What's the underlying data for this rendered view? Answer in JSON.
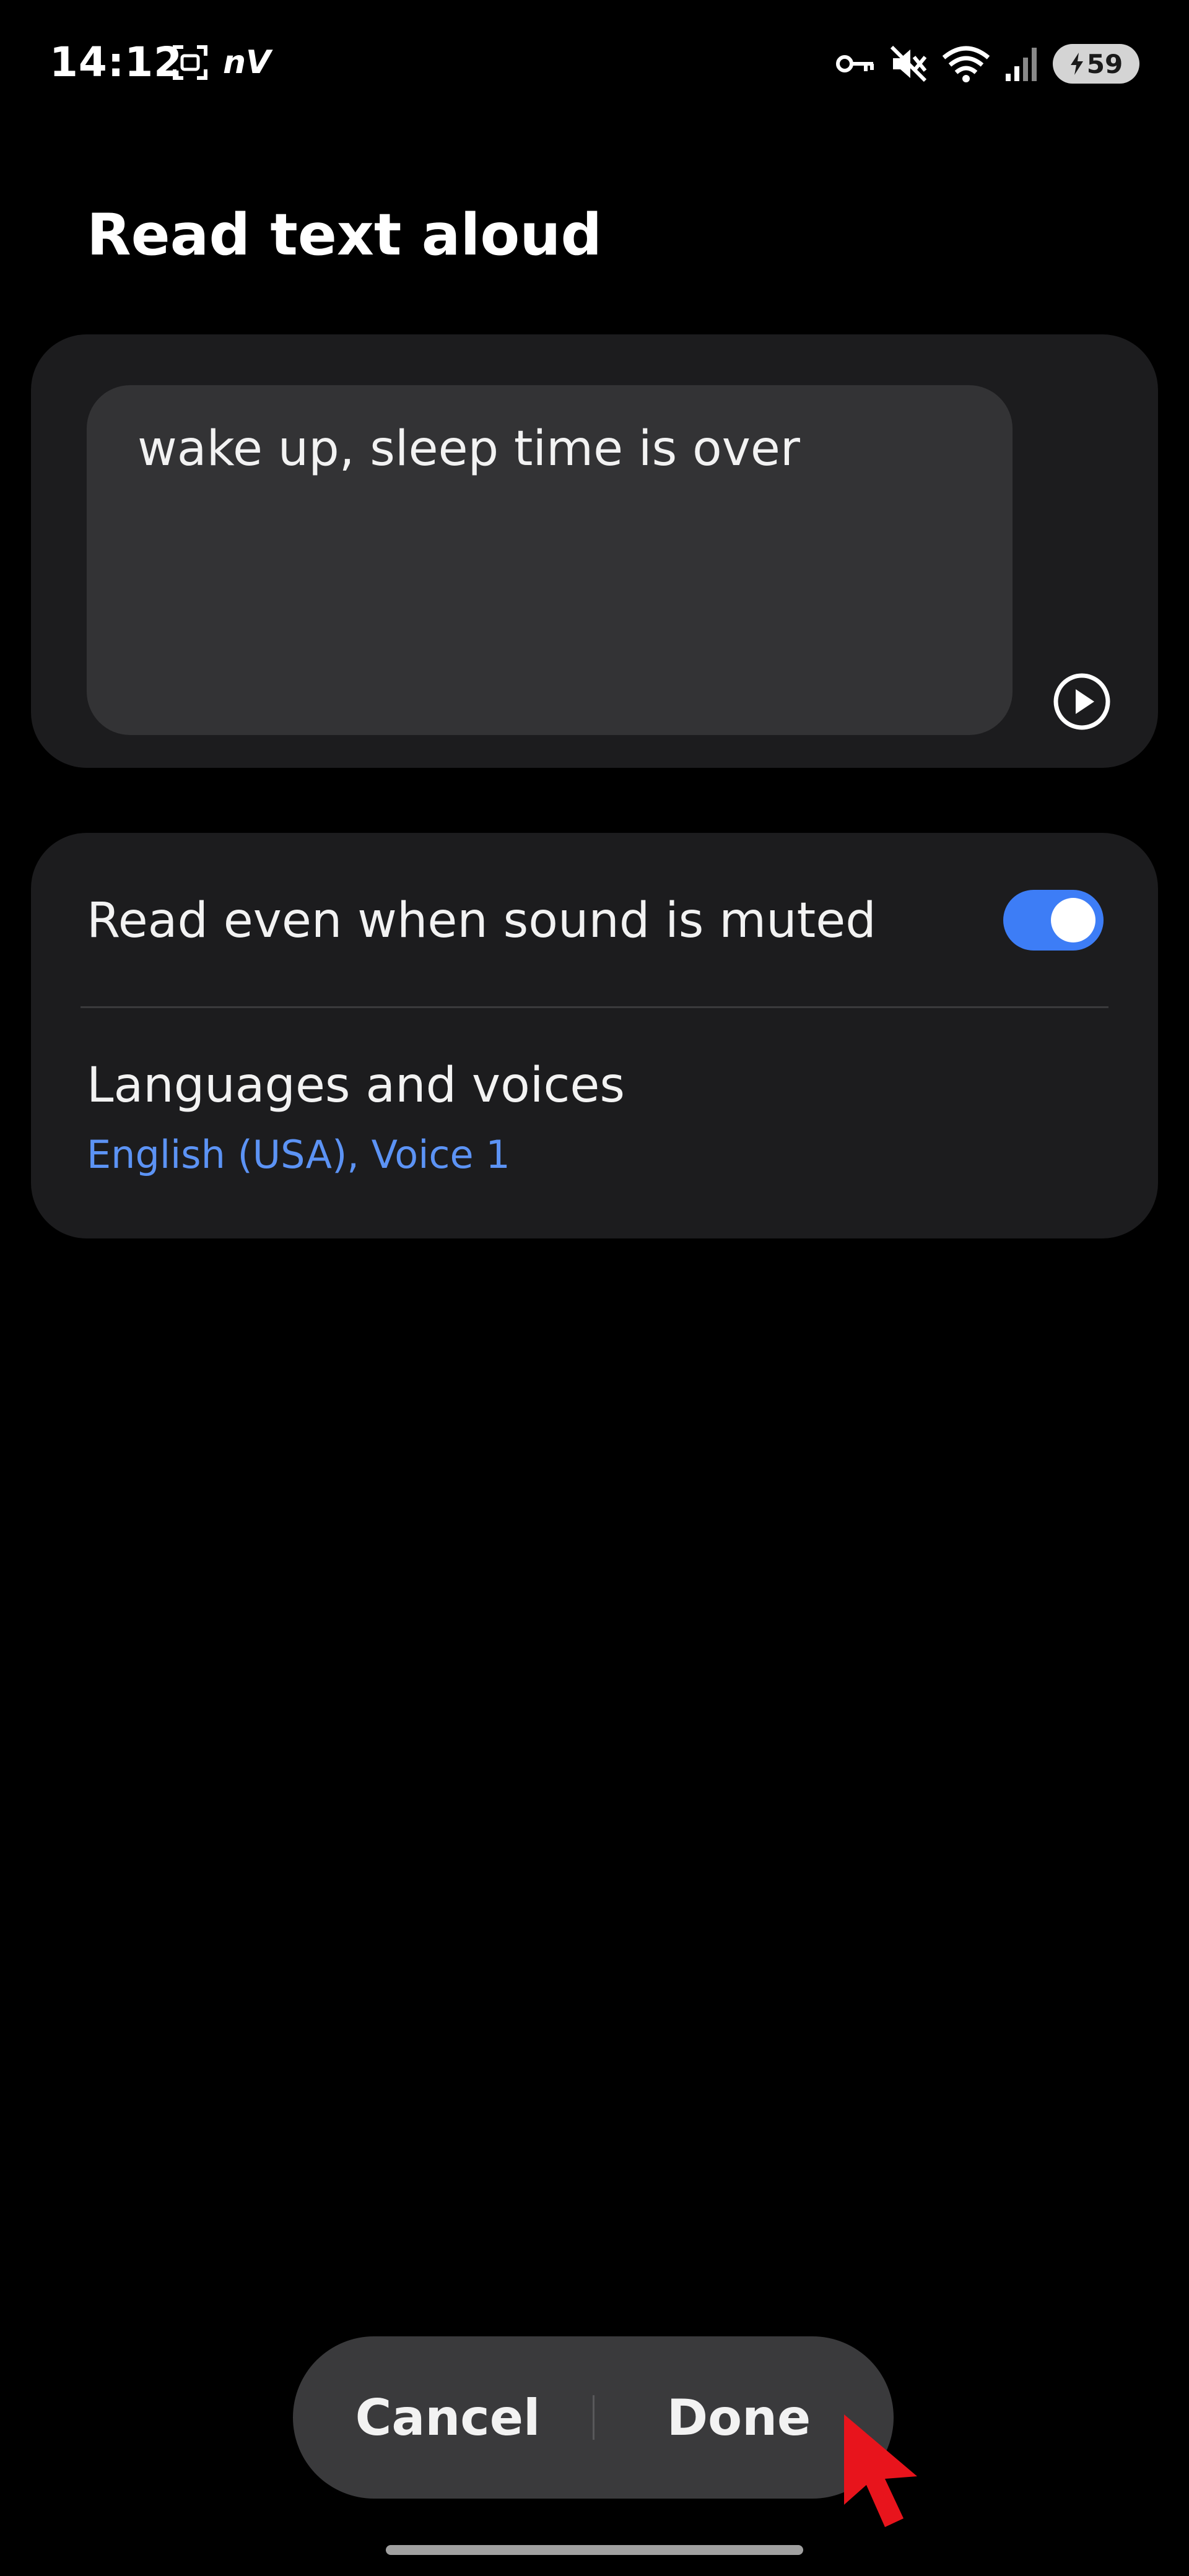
{
  "status_bar": {
    "time": "14:12",
    "carrier_label": "nV",
    "battery_level": "59",
    "icons": [
      "screenshot-icon",
      "key-icon",
      "mute-icon",
      "wifi-icon",
      "signal-icon",
      "battery-charging-icon"
    ]
  },
  "page": {
    "title": "Read text aloud"
  },
  "text_card": {
    "text_value": "wake up, sleep time is over",
    "play_icon": "play-circle-icon"
  },
  "settings": {
    "mute_read_label": "Read even when sound is muted",
    "mute_read_enabled": true,
    "languages_title": "Languages and voices",
    "languages_summary": "English (USA), Voice 1"
  },
  "actions": {
    "cancel_label": "Cancel",
    "done_label": "Done"
  },
  "colors": {
    "background": "#000000",
    "card": "#1c1c1e",
    "text_box": "#333335",
    "accent": "#3d7df6",
    "link_blue": "#5c93f5",
    "cursor": "#e8141c"
  }
}
